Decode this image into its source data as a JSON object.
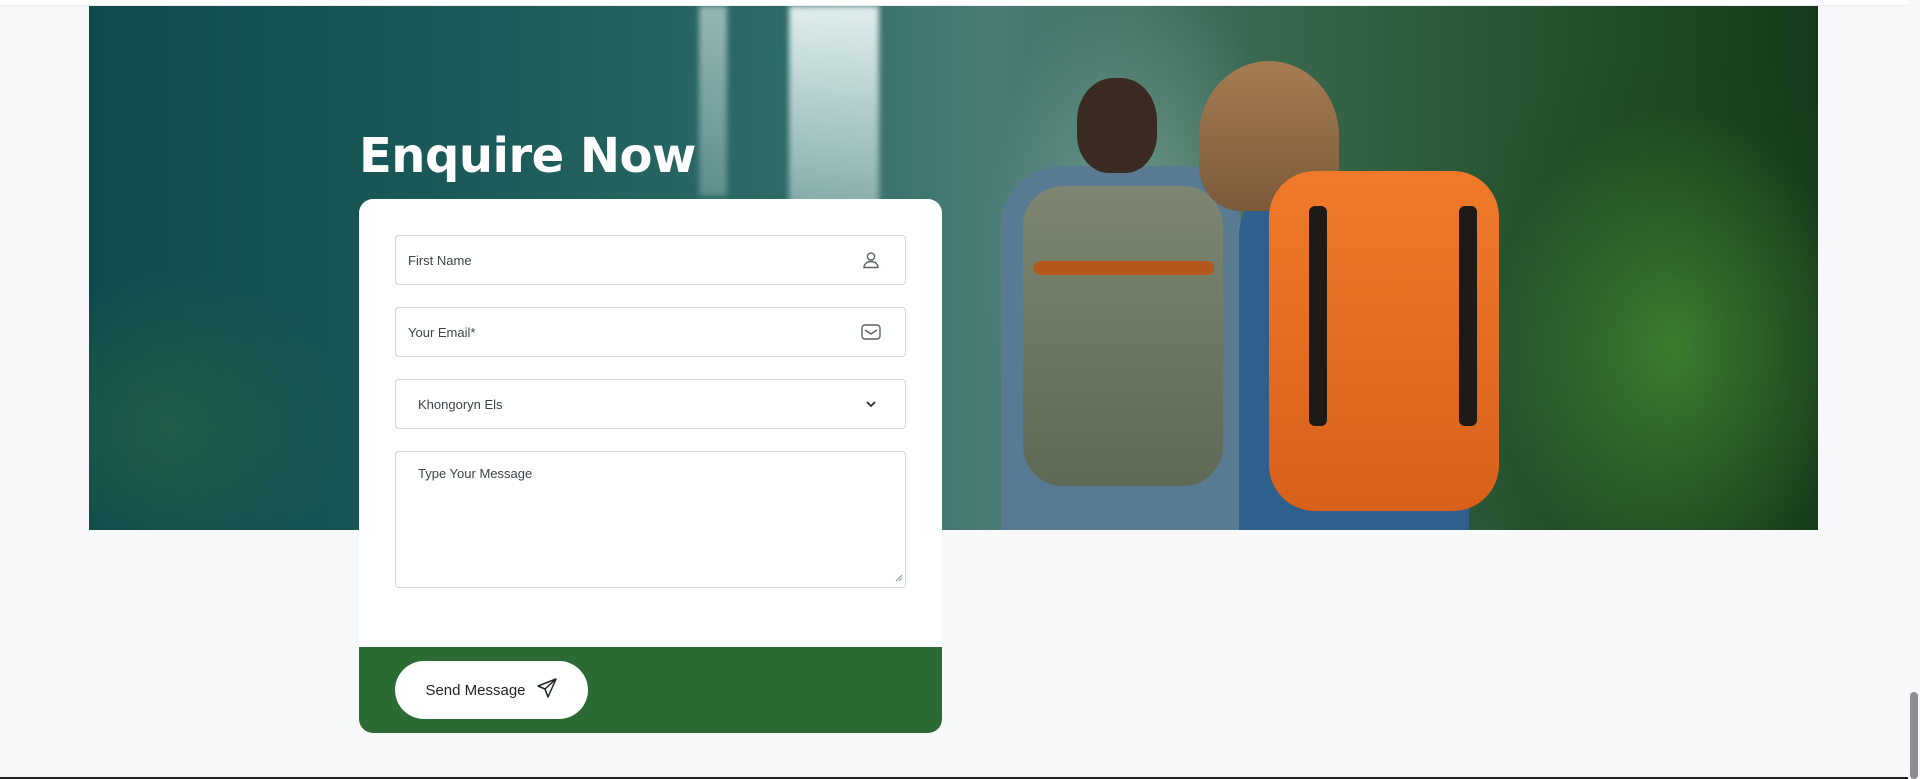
{
  "form": {
    "title": "Enquire Now",
    "first_name_placeholder": "First Name",
    "email_placeholder": "Your Email*",
    "select_value": "Khongoryn Els",
    "message_placeholder": "Type Your Message",
    "send_label": "Send Message"
  },
  "icons": {
    "first_name": "user-icon",
    "email": "mail-icon",
    "select": "chevron-down-icon",
    "send": "send-icon"
  },
  "colors": {
    "accent_green": "#2c6a33",
    "background": "#f7f8f9",
    "card": "#ffffff"
  }
}
